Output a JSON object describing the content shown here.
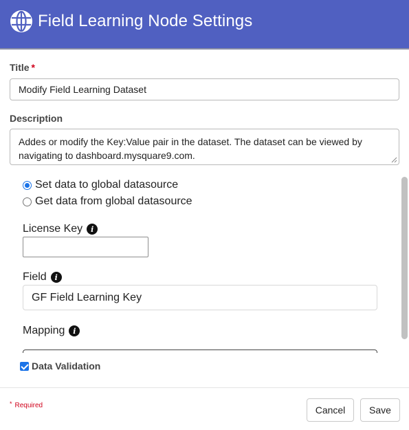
{
  "header": {
    "title": "Field Learning Node Settings",
    "icon": "globe-icon",
    "background": "#5060c1"
  },
  "form": {
    "title_label": "Title",
    "required_marker": "*",
    "title_value": "Modify Field Learning Dataset",
    "description_label": "Description",
    "description_value": "Addes or modify the Key:Value pair in the dataset.  The dataset can be viewed by navigating to dashboard.mysquare9.com.",
    "datasource_options": [
      {
        "label": "Set data to global datasource",
        "selected": true
      },
      {
        "label": "Get data from global datasource",
        "selected": false
      }
    ],
    "license_key_label": "License Key",
    "license_key_value": "",
    "field_label": "Field",
    "field_value": "GF Field Learning Key",
    "mapping_label": "Mapping",
    "mapping_value": "",
    "data_validation_label": "Data Validation",
    "data_validation_checked": true
  },
  "footer": {
    "required_marker": "*",
    "required_text": "Required",
    "cancel_label": "Cancel",
    "save_label": "Save"
  },
  "colors": {
    "accent": "#1a73e8",
    "required": "#d0021b"
  }
}
